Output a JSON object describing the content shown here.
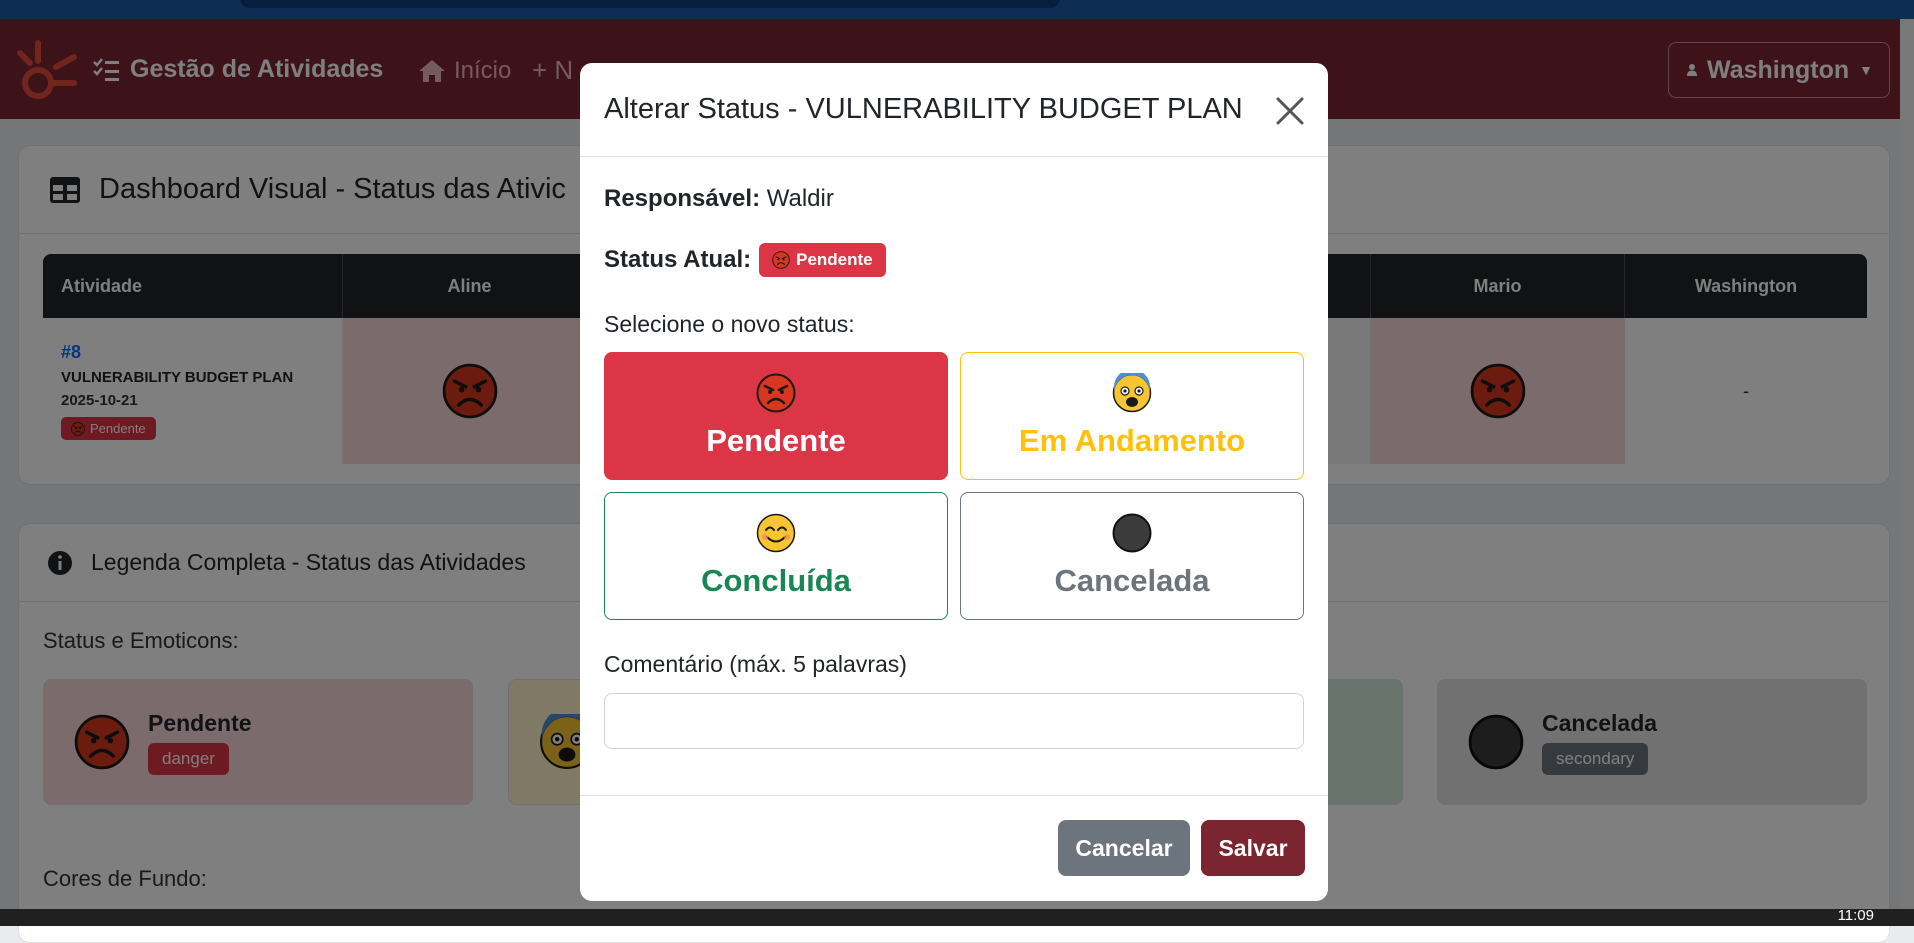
{
  "navbar": {
    "brand": "Gestão de Atividades",
    "home": "Início",
    "new_prefix": "+ N",
    "user": "Washington"
  },
  "dashboard": {
    "title": "Dashboard Visual - Status das Ativic",
    "columns": [
      "Atividade",
      "Aline",
      "Mario",
      "Washington"
    ],
    "activity": {
      "id": "#8",
      "name": "VULNERABILITY BUDGET PLAN",
      "date": "2025-10-21",
      "status": "Pendente"
    },
    "washington_cell": "-"
  },
  "legend": {
    "title": "Legenda Completa - Status das Atividades",
    "section_status": "Status e Emoticons:",
    "section_colors": "Cores de Fundo:",
    "items": [
      {
        "label": "Pendente",
        "tag": "danger"
      },
      {
        "label": "Cancelada",
        "tag": "secondary"
      }
    ]
  },
  "modal": {
    "title": "Alterar Status - VULNERABILITY BUDGET PLAN",
    "responsavel_label": "Responsável:",
    "responsavel": "Waldir",
    "status_atual_label": "Status Atual:",
    "status_atual": "Pendente",
    "select_label": "Selecione o novo status:",
    "options": [
      {
        "label": "Pendente",
        "color": "#dc3545",
        "selected": true
      },
      {
        "label": "Em Andamento",
        "color": "#ffc107",
        "selected": false
      },
      {
        "label": "Concluída",
        "color": "#198754",
        "selected": false
      },
      {
        "label": "Cancelada",
        "color": "#6c757d",
        "selected": false
      }
    ],
    "comment_label": "Comentário (máx. 5 palavras)",
    "comment_value": "",
    "cancel": "Cancelar",
    "save": "Salvar"
  },
  "taskbar": {
    "clock": "11:09"
  },
  "colors": {
    "navbar": "#7a2530",
    "danger": "#dc3545",
    "warning": "#ffc107",
    "success": "#198754",
    "secondary": "#6c757d"
  }
}
